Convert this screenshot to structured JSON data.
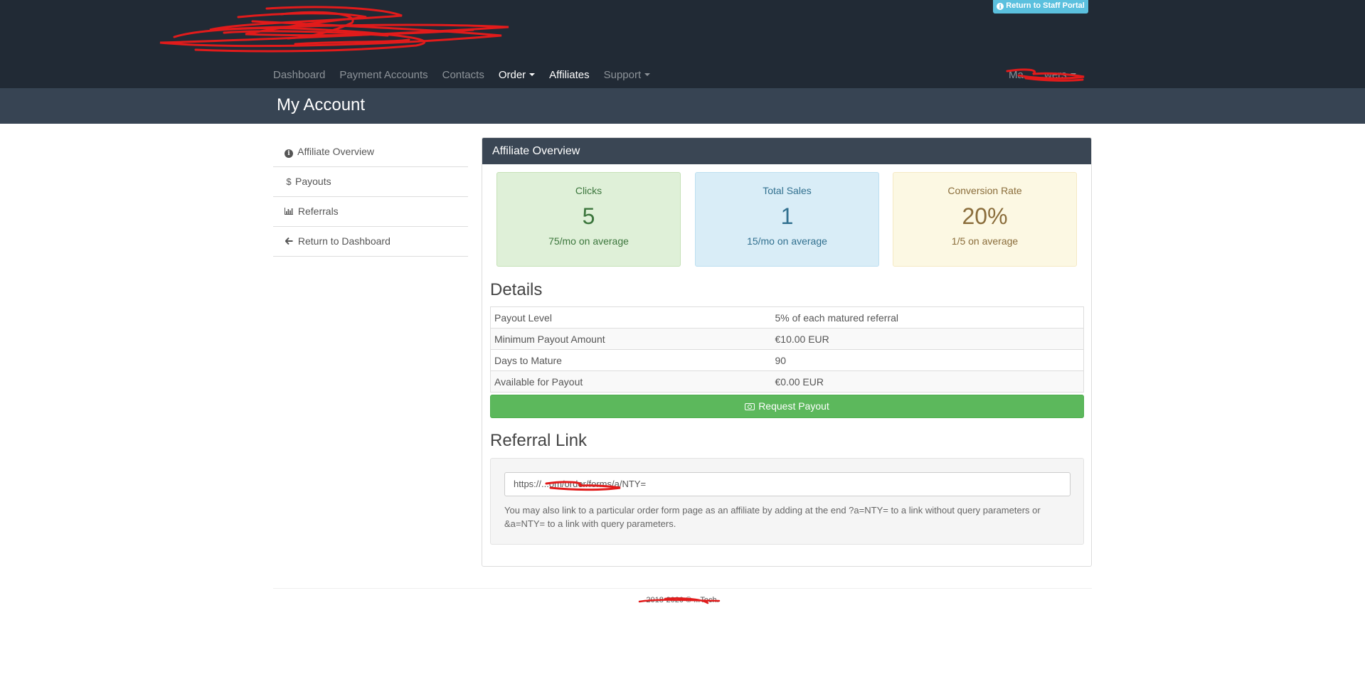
{
  "header": {
    "staff_portal_label": "Return to Staff Portal",
    "nav": [
      {
        "label": "Dashboard"
      },
      {
        "label": "Payment Accounts"
      },
      {
        "label": "Contacts"
      },
      {
        "label": "Order"
      },
      {
        "label": "Affiliates"
      },
      {
        "label": "Support"
      }
    ],
    "user_menu_label": "Ma... ...wers"
  },
  "page": {
    "title": "My Account"
  },
  "sidebar": {
    "items": [
      {
        "label": "Affiliate Overview",
        "icon": "info-circle-icon"
      },
      {
        "label": "Payouts",
        "icon": "dollar-icon"
      },
      {
        "label": "Referrals",
        "icon": "bar-chart-icon"
      },
      {
        "label": "Return to Dashboard",
        "icon": "arrow-left-icon"
      }
    ]
  },
  "overview": {
    "heading": "Affiliate Overview",
    "stats": [
      {
        "label": "Clicks",
        "value": "5",
        "sub": "75/mo on average",
        "color": "#3c763d"
      },
      {
        "label": "Total Sales",
        "value": "1",
        "sub": "15/mo on average",
        "color": "#31708f"
      },
      {
        "label": "Conversion Rate",
        "value": "20%",
        "sub": "1/5 on average",
        "color": "#8a6d3b"
      }
    ]
  },
  "details": {
    "heading": "Details",
    "rows": [
      {
        "label": "Payout Level",
        "value": "5% of each matured referral"
      },
      {
        "label": "Minimum Payout Amount",
        "value": "€10.00 EUR"
      },
      {
        "label": "Days to Mature",
        "value": "90"
      },
      {
        "label": "Available for Payout",
        "value": "€0.00 EUR"
      }
    ],
    "button_label": "Request Payout",
    "button_color": "#5cb85c"
  },
  "referral": {
    "heading": "Referral Link",
    "link_value": "https://...om/order/forms/a/NTY=",
    "help_text": "You may also link to a particular order form page as an affiliate by adding at the end ?a=NTY= to a link without query parameters or &a=NTY= to a link with query parameters."
  },
  "footer": {
    "copyright": "2018-2020 © ...Tech."
  }
}
